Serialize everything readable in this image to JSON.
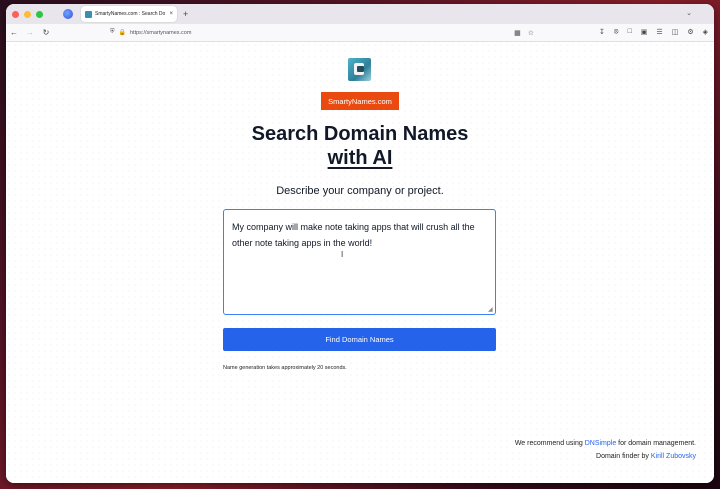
{
  "browser": {
    "tab_title": "SmartyNames.com : Search Do",
    "tab_close": "×",
    "new_tab": "+",
    "url": "https://smartynames.com"
  },
  "page": {
    "badge": "SmartyNames.com",
    "title_line1": "Search Domain Names",
    "title_line2": "with AI",
    "subtitle": "Describe your company or project.",
    "description_value": "My company will make note taking apps that will crush all the other note taking apps in the world!",
    "find_button": "Find Domain Names",
    "note": "Name generation takes approximately 20 seconds.",
    "footer_recommend_prefix": "We recommend using ",
    "footer_recommend_link": "DNSimple",
    "footer_recommend_suffix": " for domain management.",
    "footer_finder_prefix": "Domain finder by ",
    "footer_finder_link": "Kirill Zubovsky"
  },
  "colors": {
    "badge": "#ea4a10",
    "button": "#2563eb",
    "link": "#2563eb",
    "focus_border": "#3b82f6"
  }
}
